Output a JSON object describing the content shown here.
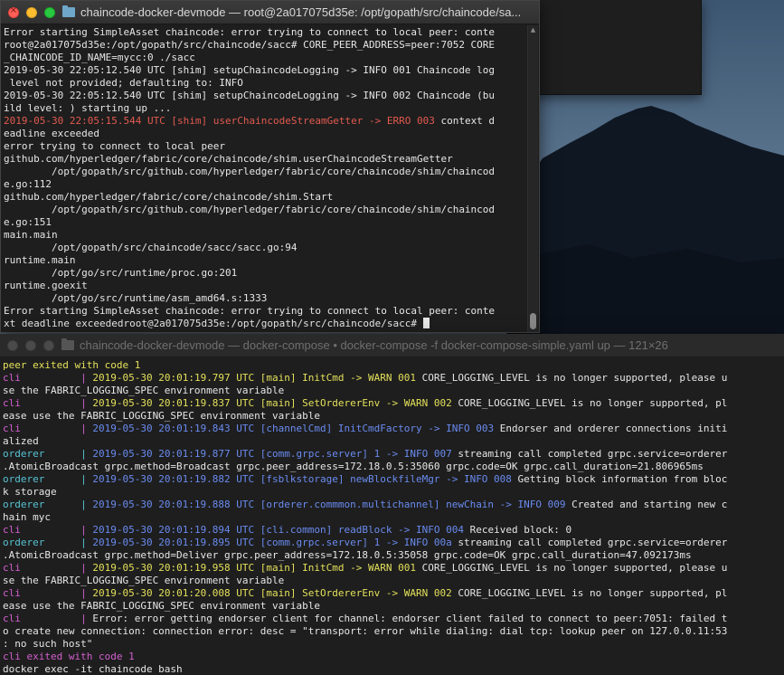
{
  "desktop": {
    "colors": {
      "sky": "#56708a",
      "mountain": "#0e1621"
    }
  },
  "terminal_top": {
    "title": "chaincode-docker-devmode — root@2a017075d35e: /opt/gopath/src/chaincode/sa...",
    "lines": [
      [
        {
          "t": "Error starting SimpleAsset chaincode: error trying to connect to local peer: conte",
          "c": "white"
        }
      ],
      [
        {
          "t": "root@2a017075d35e:/opt/gopath/src/chaincode/sacc# CORE_PEER_ADDRESS=peer:7052 CORE",
          "c": "white"
        }
      ],
      [
        {
          "t": "_CHAINCODE_ID_NAME=mycc:0 ./sacc",
          "c": "white"
        }
      ],
      [
        {
          "t": "2019-05-30 22:05:12.540 UTC [shim] setupChaincodeLogging -> INFO 001 Chaincode log",
          "c": "white"
        }
      ],
      [
        {
          "t": " level not provided; defaulting to: INFO",
          "c": "white"
        }
      ],
      [
        {
          "t": "2019-05-30 22:05:12.540 UTC [shim] setupChaincodeLogging -> INFO 002 Chaincode (bu",
          "c": "white"
        }
      ],
      [
        {
          "t": "ild level: ) starting up ...",
          "c": "white"
        }
      ],
      [
        {
          "t": "2019-05-30 22:05:15.544 UTC [shim] userChaincodeStreamGetter -> ERRO 003",
          "c": "red"
        },
        {
          "t": " context d",
          "c": "white"
        }
      ],
      [
        {
          "t": "eadline exceeded",
          "c": "white"
        }
      ],
      [
        {
          "t": "error trying to connect to local peer",
          "c": "white"
        }
      ],
      [
        {
          "t": "github.com/hyperledger/fabric/core/chaincode/shim.userChaincodeStreamGetter",
          "c": "white"
        }
      ],
      [
        {
          "t": "        /opt/gopath/src/github.com/hyperledger/fabric/core/chaincode/shim/chaincod",
          "c": "white"
        }
      ],
      [
        {
          "t": "e.go:112",
          "c": "white"
        }
      ],
      [
        {
          "t": "github.com/hyperledger/fabric/core/chaincode/shim.Start",
          "c": "white"
        }
      ],
      [
        {
          "t": "        /opt/gopath/src/github.com/hyperledger/fabric/core/chaincode/shim/chaincod",
          "c": "white"
        }
      ],
      [
        {
          "t": "e.go:151",
          "c": "white"
        }
      ],
      [
        {
          "t": "main.main",
          "c": "white"
        }
      ],
      [
        {
          "t": "        /opt/gopath/src/chaincode/sacc/sacc.go:94",
          "c": "white"
        }
      ],
      [
        {
          "t": "runtime.main",
          "c": "white"
        }
      ],
      [
        {
          "t": "        /opt/go/src/runtime/proc.go:201",
          "c": "white"
        }
      ],
      [
        {
          "t": "runtime.goexit",
          "c": "white"
        }
      ],
      [
        {
          "t": "        /opt/go/src/runtime/asm_amd64.s:1333",
          "c": "white"
        }
      ],
      [
        {
          "t": "Error starting SimpleAsset chaincode: error trying to connect to local peer: conte",
          "c": "white"
        }
      ],
      [
        {
          "t": "xt deadline exceededroot@2a017075d35e:/opt/gopath/src/chaincode/sacc# ",
          "c": "white"
        },
        {
          "cursor": true
        }
      ]
    ]
  },
  "terminal_bottom": {
    "title": "chaincode-docker-devmode — docker-compose • docker-compose -f docker-compose-simple.yaml up — 121×26",
    "lines": [
      [
        {
          "t": "peer exited with code 1",
          "c": "yellow"
        }
      ],
      [
        {
          "t": "cli",
          "c": "magenta"
        },
        {
          "t": "          | ",
          "c": "magenta"
        },
        {
          "t": "2019-05-30 20:01:19.797 UTC [main] InitCmd -> WARN 001",
          "c": "yellow"
        },
        {
          "t": " CORE_LOGGING_LEVEL is no longer supported, please u",
          "c": "white"
        }
      ],
      [
        {
          "t": "se the FABRIC_LOGGING_SPEC environment variable",
          "c": "white"
        }
      ],
      [
        {
          "t": "cli",
          "c": "magenta"
        },
        {
          "t": "          | ",
          "c": "magenta"
        },
        {
          "t": "2019-05-30 20:01:19.837 UTC [main] SetOrdererEnv -> WARN 002",
          "c": "yellow"
        },
        {
          "t": " CORE_LOGGING_LEVEL is no longer supported, pl",
          "c": "white"
        }
      ],
      [
        {
          "t": "ease use the FABRIC_LOGGING_SPEC environment variable",
          "c": "white"
        }
      ],
      [
        {
          "t": "cli",
          "c": "magenta"
        },
        {
          "t": "          | ",
          "c": "magenta"
        },
        {
          "t": "2019-05-30 20:01:19.843 UTC [channelCmd] InitCmdFactory -> INFO 003",
          "c": "blue"
        },
        {
          "t": " Endorser and orderer connections initi",
          "c": "white"
        }
      ],
      [
        {
          "t": "alized",
          "c": "white"
        }
      ],
      [
        {
          "t": "orderer",
          "c": "cyan"
        },
        {
          "t": "      | ",
          "c": "cyan"
        },
        {
          "t": "2019-05-30 20:01:19.877 UTC [comm.grpc.server] 1 -> INFO 007",
          "c": "blue"
        },
        {
          "t": " streaming call completed grpc.service=orderer",
          "c": "white"
        }
      ],
      [
        {
          "t": ".AtomicBroadcast grpc.method=Broadcast grpc.peer_address=172.18.0.5:35060 grpc.code=OK grpc.call_duration=21.806965ms",
          "c": "white"
        }
      ],
      [
        {
          "t": "orderer",
          "c": "cyan"
        },
        {
          "t": "      | ",
          "c": "cyan"
        },
        {
          "t": "2019-05-30 20:01:19.882 UTC [fsblkstorage] newBlockfileMgr -> INFO 008",
          "c": "blue"
        },
        {
          "t": " Getting block information from bloc",
          "c": "white"
        }
      ],
      [
        {
          "t": "k storage",
          "c": "white"
        }
      ],
      [
        {
          "t": "orderer",
          "c": "cyan"
        },
        {
          "t": "      | ",
          "c": "cyan"
        },
        {
          "t": "2019-05-30 20:01:19.888 UTC [orderer.commmon.multichannel] newChain -> INFO 009",
          "c": "blue"
        },
        {
          "t": " Created and starting new c",
          "c": "white"
        }
      ],
      [
        {
          "t": "hain myc",
          "c": "white"
        }
      ],
      [
        {
          "t": "cli",
          "c": "magenta"
        },
        {
          "t": "          | ",
          "c": "magenta"
        },
        {
          "t": "2019-05-30 20:01:19.894 UTC [cli.common] readBlock -> INFO 004",
          "c": "blue"
        },
        {
          "t": " Received block: 0",
          "c": "white"
        }
      ],
      [
        {
          "t": "orderer",
          "c": "cyan"
        },
        {
          "t": "      | ",
          "c": "cyan"
        },
        {
          "t": "2019-05-30 20:01:19.895 UTC [comm.grpc.server] 1 -> INFO 00a",
          "c": "blue"
        },
        {
          "t": " streaming call completed grpc.service=orderer",
          "c": "white"
        }
      ],
      [
        {
          "t": ".AtomicBroadcast grpc.method=Deliver grpc.peer_address=172.18.0.5:35058 grpc.code=OK grpc.call_duration=47.092173ms",
          "c": "white"
        }
      ],
      [
        {
          "t": "cli",
          "c": "magenta"
        },
        {
          "t": "          | ",
          "c": "magenta"
        },
        {
          "t": "2019-05-30 20:01:19.958 UTC [main] InitCmd -> WARN 001",
          "c": "yellow"
        },
        {
          "t": " CORE_LOGGING_LEVEL is no longer supported, please u",
          "c": "white"
        }
      ],
      [
        {
          "t": "se the FABRIC_LOGGING_SPEC environment variable",
          "c": "white"
        }
      ],
      [
        {
          "t": "cli",
          "c": "magenta"
        },
        {
          "t": "          | ",
          "c": "magenta"
        },
        {
          "t": "2019-05-30 20:01:20.008 UTC [main] SetOrdererEnv -> WARN 002",
          "c": "yellow"
        },
        {
          "t": " CORE_LOGGING_LEVEL is no longer supported, pl",
          "c": "white"
        }
      ],
      [
        {
          "t": "ease use the FABRIC_LOGGING_SPEC environment variable",
          "c": "white"
        }
      ],
      [
        {
          "t": "cli",
          "c": "magenta"
        },
        {
          "t": "          | ",
          "c": "magenta"
        },
        {
          "t": "Error: error getting endorser client for channel: endorser client failed to connect to peer:7051: failed t",
          "c": "white"
        }
      ],
      [
        {
          "t": "o create new connection: connection error: desc = \"transport: error while dialing: dial tcp: lookup peer on 127.0.0.11:53",
          "c": "white"
        }
      ],
      [
        {
          "t": ": no such host\"",
          "c": "white"
        }
      ],
      [
        {
          "t": "cli exited with code 1",
          "c": "magenta"
        }
      ],
      [
        {
          "t": "docker exec -it chaincode bash",
          "c": "white"
        }
      ]
    ]
  }
}
